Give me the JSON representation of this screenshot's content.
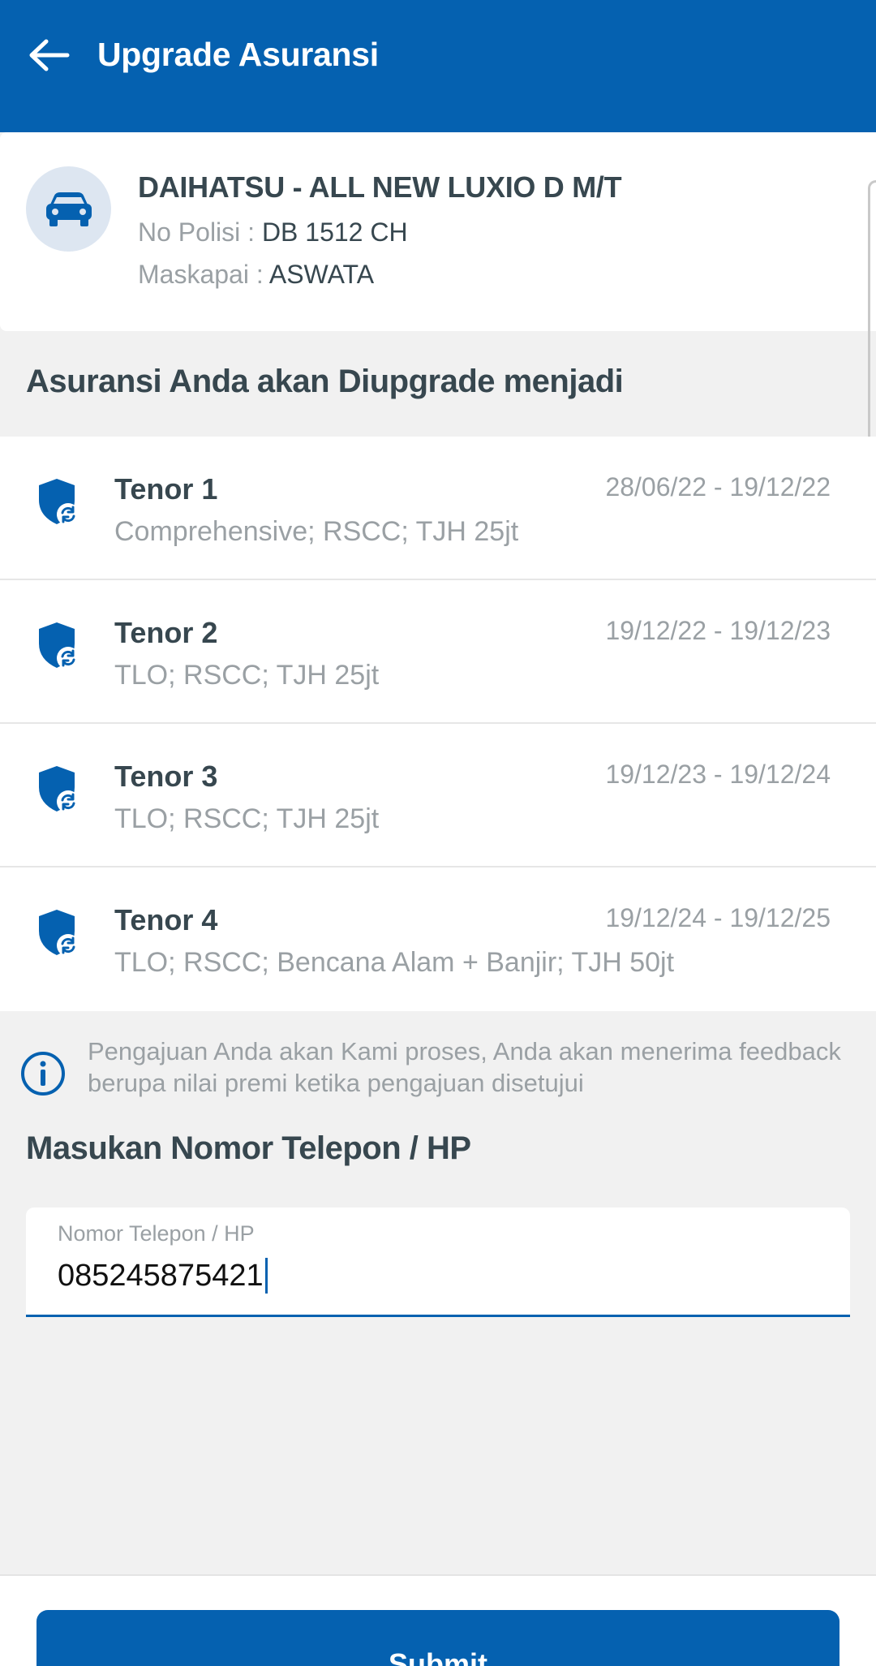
{
  "appbar": {
    "title": "Upgrade Asuransi",
    "color": "#0561b0"
  },
  "vehicle": {
    "icon": "car-icon",
    "name": "DAIHATSU - ALL NEW LUXIO D M/T",
    "police_label": "No Polisi :",
    "police_value": "DB 1512 CH",
    "carrier_label": "Maskapai :",
    "carrier_value": "ASWATA"
  },
  "upgrade_section": {
    "title": "Asuransi Anda akan Diupgrade menjadi",
    "tenors": [
      {
        "icon": "shield-refresh-icon",
        "title": "Tenor 1",
        "period": "28/06/22 - 19/12/22",
        "coverage": "Comprehensive; RSCC; TJH 25jt"
      },
      {
        "icon": "shield-refresh-icon",
        "title": "Tenor 2",
        "period": "19/12/22 - 19/12/23",
        "coverage": "TLO; RSCC; TJH 25jt"
      },
      {
        "icon": "shield-refresh-icon",
        "title": "Tenor 3",
        "period": "19/12/23 - 19/12/24",
        "coverage": "TLO; RSCC; TJH 25jt"
      },
      {
        "icon": "shield-refresh-icon",
        "title": "Tenor 4",
        "period": "19/12/24 - 19/12/25",
        "coverage": "TLO; RSCC; Bencana Alam + Banjir; TJH 50jt"
      }
    ]
  },
  "info": {
    "icon": "info-icon",
    "text": "Pengajuan Anda akan Kami proses, Anda akan menerima feedback berupa nilai premi ketika pengajuan disetujui"
  },
  "phone": {
    "heading": "Masukan Nomor Telepon / HP",
    "label": "Nomor Telepon / HP",
    "value": "085245875421"
  },
  "submit": {
    "label": "Submit"
  }
}
